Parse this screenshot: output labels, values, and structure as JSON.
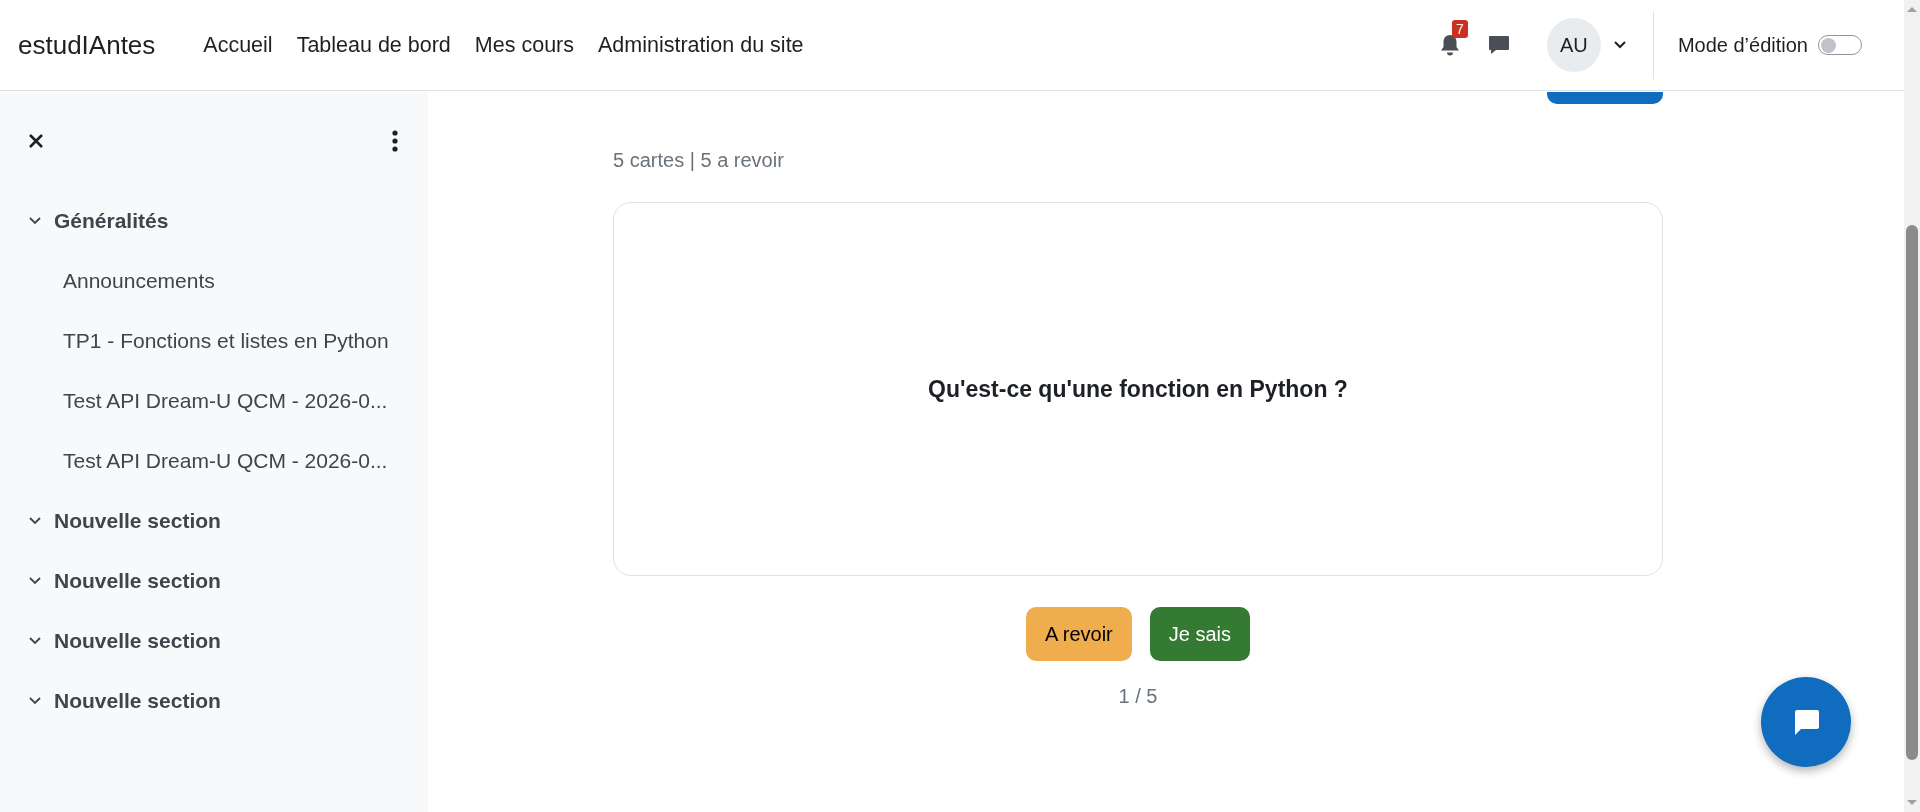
{
  "navbar": {
    "brand": "estudIAntes",
    "links": [
      {
        "label": "Accueil"
      },
      {
        "label": "Tableau de bord"
      },
      {
        "label": "Mes cours"
      },
      {
        "label": "Administration du site"
      }
    ],
    "notification_count": "7",
    "avatar": "AU",
    "edit_mode": {
      "label": "Mode d’édition",
      "on": false
    }
  },
  "sidebar": {
    "sections": [
      {
        "title": "Généralités",
        "expanded": true,
        "children": [
          {
            "label": "Announcements"
          },
          {
            "label": "TP1 - Fonctions et listes en Python"
          },
          {
            "label": "Test API Dream-U QCM - 2026-0..."
          },
          {
            "label": "Test API Dream-U QCM - 2026-0..."
          }
        ]
      },
      {
        "title": "Nouvelle section",
        "expanded": true
      },
      {
        "title": "Nouvelle section",
        "expanded": true
      },
      {
        "title": "Nouvelle section",
        "expanded": true
      },
      {
        "title": "Nouvelle section",
        "expanded": true
      }
    ]
  },
  "page": {
    "stats": "5 cartes | 5 a revoir",
    "card": {
      "question": "Qu'est-ce qu'une fonction en Python ?"
    },
    "buttons": [
      {
        "label": "A revoir",
        "kind": "review"
      },
      {
        "label": "Je sais",
        "kind": "known"
      }
    ],
    "progress": "1 / 5"
  }
}
